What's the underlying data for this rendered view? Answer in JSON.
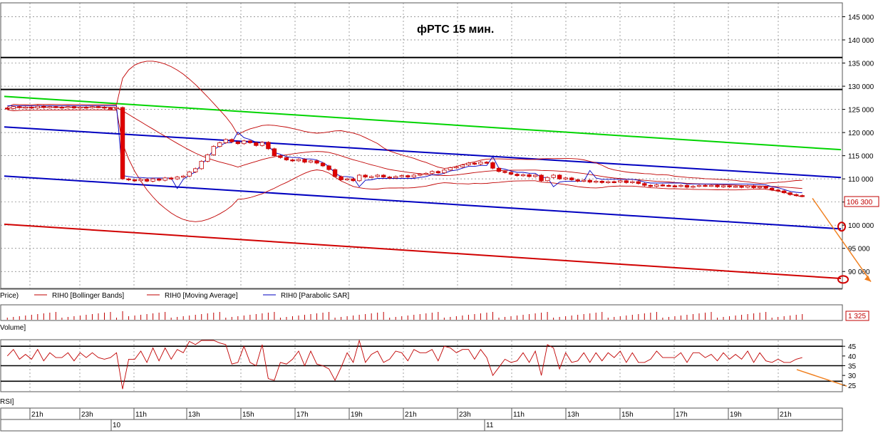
{
  "chart_data": [
    {
      "type": "candlestick",
      "title": "фРТС   15 мин.",
      "ylim": [
        86500,
        148000
      ],
      "yticks": [
        "145 000",
        "140 000",
        "135 000",
        "130 000",
        "125 000",
        "120 000",
        "115 000",
        "110 000",
        "105 000",
        "100 000",
        "95 000",
        "90 000"
      ],
      "ytick_values": [
        145000,
        140000,
        135000,
        130000,
        125000,
        120000,
        115000,
        110000,
        105000,
        100000,
        95000,
        90000
      ],
      "last_price_label": "106 300",
      "legend": [
        "Price)",
        "RIH0 [Bollinger Bands]",
        "RIH0 [Moving Average]",
        "RIH0 [Parabolic SAR]"
      ],
      "trend_lines": [
        {
          "color": "#00d400",
          "from": [
            0,
            127800
          ],
          "to": [
            145,
            116300
          ]
        },
        {
          "color": "#0000c0",
          "from": [
            0,
            121200
          ],
          "to": [
            145,
            110300
          ]
        },
        {
          "color": "#0000c0",
          "from": [
            0,
            110600
          ],
          "to": [
            145,
            99200
          ]
        },
        {
          "color": "#d00000",
          "from": [
            0,
            100200
          ],
          "to": [
            145,
            88500
          ]
        }
      ],
      "horizontal_lines": [
        136200,
        129300
      ],
      "series": [
        {
          "name": "Price",
          "ohlc_close": [
            125200,
            125600,
            125400,
            125500,
            125300,
            125700,
            125400,
            125600,
            125500,
            125400,
            125600,
            125300,
            125500,
            125400,
            125600,
            125500,
            125300,
            125200,
            125400,
            110000,
            109800,
            109600,
            109900,
            109500,
            110000,
            109700,
            110200,
            110000,
            110400,
            110600,
            111500,
            112200,
            113800,
            115200,
            117000,
            117800,
            118500,
            118000,
            117600,
            118200,
            117800,
            117200,
            117900,
            116500,
            115000,
            114600,
            114100,
            113900,
            114200,
            113600,
            113900,
            113400,
            112800,
            112000,
            110500,
            109800,
            110000,
            109600,
            110800,
            110400,
            110500,
            110800,
            110400,
            110200,
            110500,
            110700,
            110400,
            110800,
            111000,
            111200,
            111600,
            111300,
            111900,
            112400,
            112600,
            113000,
            113400,
            113200,
            113600,
            113500,
            112300,
            111600,
            111400,
            111000,
            110700,
            110900,
            110500,
            110800,
            109600,
            110300,
            110800,
            110000,
            110200,
            109800,
            109500,
            109700,
            109300,
            109500,
            109200,
            109400,
            109300,
            109600,
            109200,
            109400,
            109000,
            108600,
            108400,
            108700,
            108600,
            108500,
            108400,
            108600,
            108200,
            108400,
            108600,
            108500,
            108600,
            108300,
            108500,
            108300,
            108400,
            108200,
            108500,
            108100,
            108300,
            108000,
            107600,
            107400,
            107000,
            106600,
            106400,
            106300
          ]
        },
        {
          "name": "Volume",
          "label": "1 325"
        },
        {
          "name": "RSI",
          "yticks": [
            "45",
            "40",
            "35",
            "30",
            "25"
          ],
          "ytick_values": [
            45,
            40,
            35,
            30,
            25
          ]
        }
      ]
    }
  ],
  "x_axis": {
    "hour_labels": [
      "21h",
      "23h",
      "11h",
      "13h",
      "15h",
      "17h",
      "19h",
      "21h",
      "23h",
      "11h",
      "13h",
      "15h",
      "17h",
      "19h",
      "21h"
    ],
    "day_labels": [
      "10",
      "11"
    ]
  },
  "panel_labels": {
    "price_legend_prefix": "Price)",
    "bb": "RIH0 [Bollinger Bands]",
    "ma": "RIH0 [Moving Average]",
    "sar": "RIH0 [Parabolic SAR]",
    "volume": "Volume]",
    "rsi": "RSI]"
  },
  "colors": {
    "up_candle": "#ffffff",
    "down_candle": "#e00000",
    "bands": "#c00000",
    "sar": "#0000c0",
    "annotation": "#f08020",
    "grid": "#7a7a7a"
  }
}
